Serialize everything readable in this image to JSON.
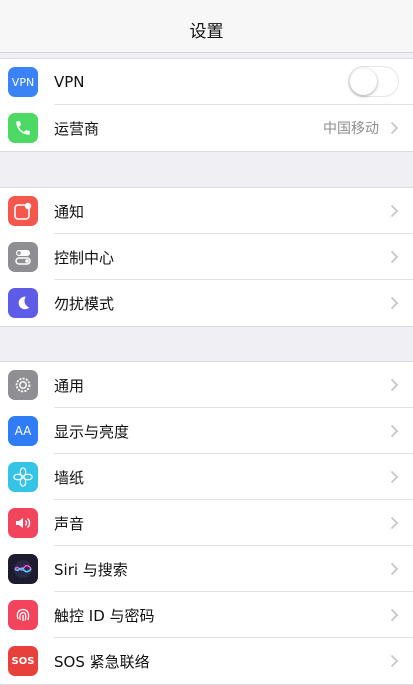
{
  "nav": {
    "title": "设置"
  },
  "group1": [
    {
      "label": "VPN",
      "icon_text": "VPN",
      "icon": "vpn-icon",
      "color": "#3a82f6",
      "control": "toggle",
      "toggle_on": false
    },
    {
      "label": "运营商",
      "icon": "phone-icon",
      "color": "#4cd964",
      "value": "中国移动"
    }
  ],
  "group2": [
    {
      "label": "通知",
      "icon": "notifications-icon",
      "color": "#f4574c"
    },
    {
      "label": "控制中心",
      "icon": "control-center-icon",
      "color": "#8e8e93"
    },
    {
      "label": "勿扰模式",
      "icon": "moon-icon",
      "color": "#5e5ce6"
    }
  ],
  "group3": [
    {
      "label": "通用",
      "icon": "gear-icon",
      "color": "#8e8e93"
    },
    {
      "label": "显示与亮度",
      "icon_text": "AA",
      "icon": "display-brightness-icon",
      "color": "#2f7cf6"
    },
    {
      "label": "墙纸",
      "icon": "wallpaper-icon",
      "color": "#35c3e6"
    },
    {
      "label": "声音",
      "icon": "speaker-icon",
      "color": "#f3445d"
    },
    {
      "label": "Siri 与搜索",
      "icon": "siri-icon",
      "color": "#1c1c2e"
    },
    {
      "label": "触控 ID 与密码",
      "icon": "fingerprint-icon",
      "color": "#f3445d"
    },
    {
      "label": "SOS 紧急联络",
      "icon_text": "SOS",
      "icon": "sos-icon",
      "color": "#e8413b"
    }
  ]
}
